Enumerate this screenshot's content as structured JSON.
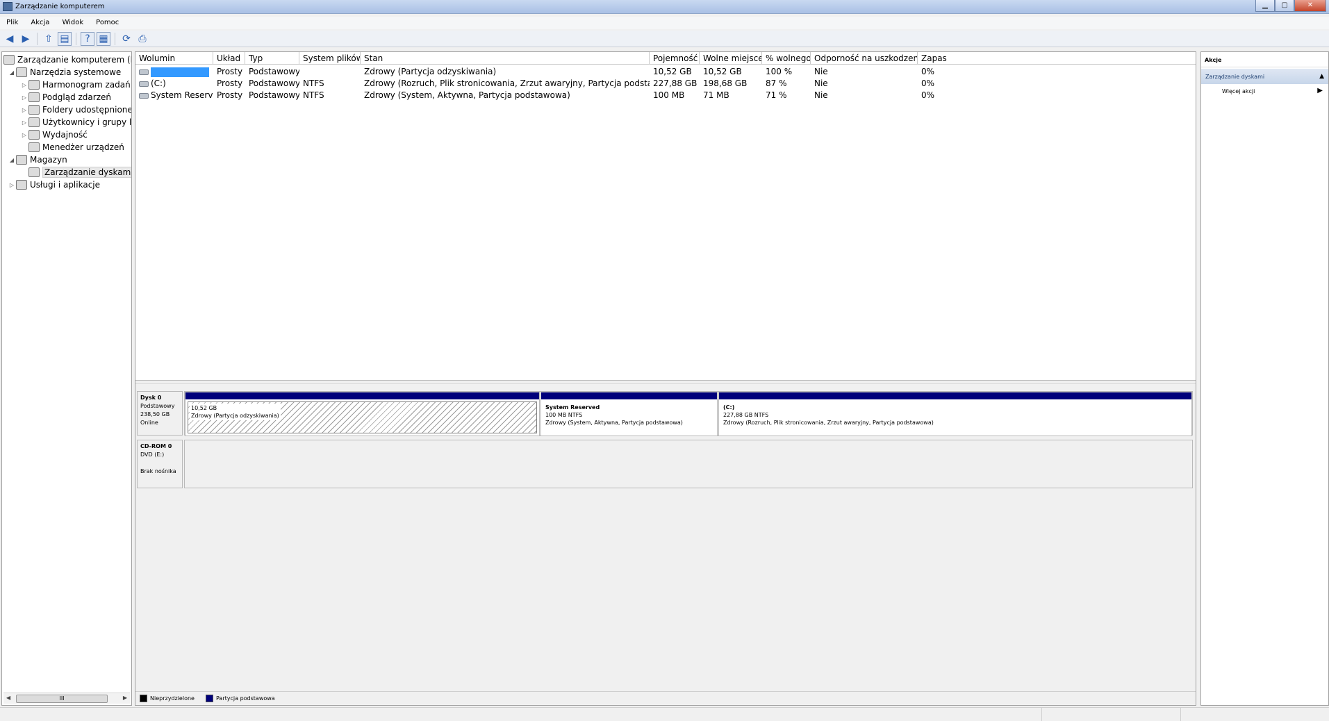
{
  "window": {
    "title": "Zarządzanie komputerem",
    "btn_min": "▁",
    "btn_max": "▢",
    "btn_close": "✕"
  },
  "menu": [
    {
      "label": "Plik"
    },
    {
      "label": "Akcja"
    },
    {
      "label": "Widok"
    },
    {
      "label": "Pomoc"
    }
  ],
  "toolbar": {
    "back": "◀",
    "forward": "▶",
    "up": "⇧",
    "show_tree": "▤",
    "help": "?",
    "console": "▦",
    "refresh": "⟳",
    "export": "⎙"
  },
  "tree": {
    "root": "Zarządzanie komputerem (lokalne)",
    "items": [
      {
        "label": "Narzędzia systemowe",
        "expander": "◢",
        "icon": "tools-icon"
      },
      {
        "label": "Harmonogram zadań",
        "expander": "▷",
        "icon": "clock-icon"
      },
      {
        "label": "Podgląd zdarzeń",
        "expander": "▷",
        "icon": "event-viewer-icon"
      },
      {
        "label": "Foldery udostępnione",
        "expander": "▷",
        "icon": "shared-folder-icon"
      },
      {
        "label": "Użytkownicy i grupy lokalne",
        "expander": "▷",
        "icon": "users-icon"
      },
      {
        "label": "Wydajność",
        "expander": "▷",
        "icon": "performance-icon"
      },
      {
        "label": "Menedżer urządzeń",
        "expander": "",
        "icon": "device-manager-icon"
      },
      {
        "label": "Magazyn",
        "expander": "◢",
        "icon": "storage-icon"
      },
      {
        "label": "Zarządzanie dyskami",
        "expander": "",
        "icon": "disk-management-icon"
      },
      {
        "label": "Usługi i aplikacje",
        "expander": "▷",
        "icon": "services-icon"
      }
    ],
    "scroll_thumb": "III",
    "scroll_left": "◀",
    "scroll_right": "▶"
  },
  "volumes": {
    "columns": [
      "Wolumin",
      "Układ",
      "Typ",
      "System plików",
      "Stan",
      "Pojemność",
      "Wolne miejsce",
      "% wolnego",
      "Odporność na uszkodzenia",
      "Zapas"
    ],
    "rows": [
      {
        "name": "",
        "layout": "Prosty",
        "type": "Podstawowy",
        "fs": "",
        "status": "Zdrowy (Partycja odzyskiwania)",
        "capacity": "10,52 GB",
        "free": "10,52 GB",
        "pct": "100 %",
        "fault": "Nie",
        "overhead": "0%"
      },
      {
        "name": "(C:)",
        "layout": "Prosty",
        "type": "Podstawowy",
        "fs": "NTFS",
        "status": "Zdrowy (Rozruch, Plik stronicowania, Zrzut awaryjny, Partycja podstawowa)",
        "capacity": "227,88 GB",
        "free": "198,68 GB",
        "pct": "87 %",
        "fault": "Nie",
        "overhead": "0%"
      },
      {
        "name": "System Reserved",
        "layout": "Prosty",
        "type": "Podstawowy",
        "fs": "NTFS",
        "status": "Zdrowy (System, Aktywna, Partycja podstawowa)",
        "capacity": "100 MB",
        "free": "71 MB",
        "pct": "71 %",
        "fault": "Nie",
        "overhead": "0%"
      }
    ]
  },
  "disks": [
    {
      "name": "Dysk 0",
      "type": "Podstawowy",
      "size": "238,50 GB",
      "state": "Online",
      "partitions": [
        {
          "title": "",
          "line1": "10,52 GB",
          "line2": "Zdrowy (Partycja odzyskiwania)"
        },
        {
          "title": "System Reserved",
          "line1": "100 MB NTFS",
          "line2": "Zdrowy (System, Aktywna, Partycja podstawowa)"
        },
        {
          "title": "(C:)",
          "line1": "227,88 GB NTFS",
          "line2": "Zdrowy (Rozruch, Plik stronicowania, Zrzut awaryjny, Partycja podstawowa)"
        }
      ]
    },
    {
      "name": "CD-ROM 0",
      "type": "DVD (E:)",
      "size": "",
      "state": "Brak nośnika",
      "partitions": []
    }
  ],
  "legend": [
    {
      "label": "Nieprzydzielone",
      "color": "#000000"
    },
    {
      "label": "Partycja podstawowa",
      "color": "#00007b"
    }
  ],
  "actions": {
    "header": "Akcje",
    "section": "Zarządzanie dyskami",
    "section_arrow": "▲",
    "more": "Więcej akcji",
    "more_arrow": "▶"
  }
}
